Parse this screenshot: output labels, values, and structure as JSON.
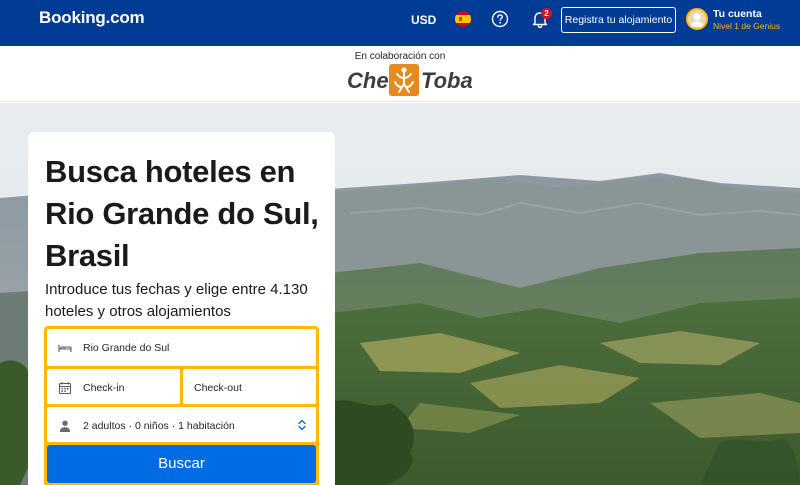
{
  "colors": {
    "brand_blue": "#003b95",
    "accent_yellow": "#febb02",
    "button_blue": "#006ce4",
    "badge_red": "#d4111e"
  },
  "header": {
    "logo": "Booking.com",
    "currency": "USD",
    "language_icon": "spain-flag-icon",
    "help_icon": "help-circle-icon",
    "notifications_icon": "bell-icon",
    "notifications_count": "2",
    "register_label": "Registra tu alojamiento",
    "account_title": "Tu cuenta",
    "account_level": "Nivel 1 de Genius"
  },
  "partner": {
    "label": "En colaboración con",
    "logo_text_left": "Che",
    "logo_text_right": "Toba"
  },
  "search": {
    "headline": "Busca hoteles en Rio Grande do Sul, Brasil",
    "subline": "Introduce tus fechas y elige entre 4.130 hoteles y otros alojamientos",
    "destination_value": "Rio Grande do Sul",
    "checkin_placeholder": "Check-in",
    "checkout_placeholder": "Check-out",
    "occupancy_summary": "2 adultos · 0 niños · 1 habitación",
    "submit_label": "Buscar"
  }
}
